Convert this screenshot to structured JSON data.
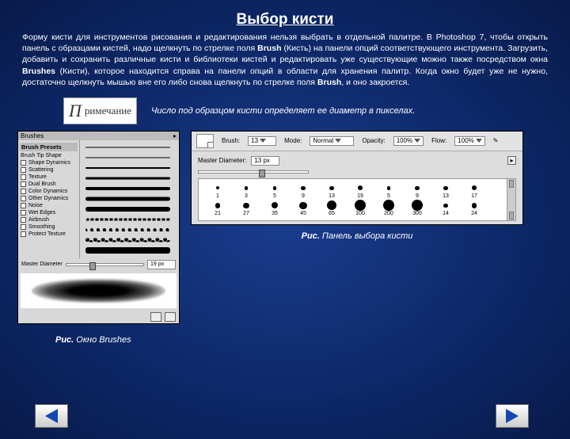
{
  "title": "Выбор кисти",
  "paragraph_parts": {
    "p1a": "Форму кисти для инструментов рисования и редактирования нельзя выбрать в отдельной палитре. В Photoshop 7, чтобы открыть панель с образцами кистей, надо щелкнуть по стрелке поля ",
    "brush1": "Brush",
    "p1b": " (Кисть) на панели опций соответствующего инструмента. Загрузить, добавить и сохранить различные кисти и библиотеки кистей и редактировать уже существующие можно также посредством окна ",
    "brushes": "Brushes",
    "p1c": " (Кисти), которое находится справа на панели опций в области для хранения палитр. Когда окно будет уже не нужно, достаточно щелкнуть мышью вне его либо снова щелкнуть по стрелке поля ",
    "brush2": "Brush",
    "p1d": ", и оно закроется."
  },
  "note_box": {
    "letter": "П",
    "rest": "римечание"
  },
  "note_text": "Число под образцом кисти определяет ее диаметр в пикселах.",
  "brushes_window": {
    "tab": "Brushes",
    "header": "Brush Presets",
    "tip": "Brush Tip Shape",
    "options": [
      "Shape Dynamics",
      "Scattering",
      "Texture",
      "Dual Brush",
      "Color Dynamics",
      "Other Dynamics",
      "Noise",
      "Wet Edges",
      "Airbrush",
      "Smoothing",
      "Protect Texture"
    ],
    "diameter_label": "Master Diameter",
    "diameter_value": "19 px"
  },
  "option_panel": {
    "bar": {
      "brush_label": "Brush:",
      "brush_val": "13",
      "mode_label": "Mode:",
      "mode_val": "Normal",
      "opacity_label": "Opacity:",
      "opacity_val": "100%",
      "flow_label": "Flow:",
      "flow_val": "100%"
    },
    "md_label": "Master Diameter:",
    "md_val": "13 px",
    "rows": [
      [
        1,
        3,
        5,
        9,
        13,
        19,
        5,
        9,
        13,
        17
      ],
      [
        21,
        27,
        35,
        45,
        65,
        100,
        200,
        300,
        14,
        24
      ]
    ]
  },
  "caption_right": {
    "pre": "Рис.",
    "text": " Панель выбора кисти"
  },
  "caption_left": {
    "pre": "Рис.",
    "text": " Окно Brushes"
  },
  "nav": {
    "prev": "prev",
    "next": "next"
  }
}
